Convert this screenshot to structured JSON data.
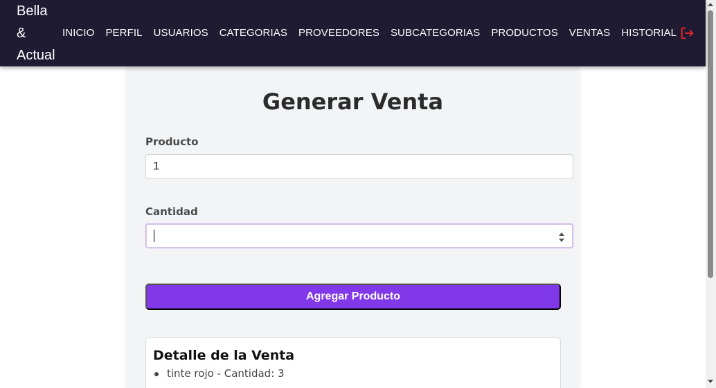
{
  "brand": {
    "line1": "Bella",
    "line2": "&",
    "line3": "Actual"
  },
  "nav": {
    "items": [
      "INICIO",
      "PERFIL",
      "USUARIOS",
      "CATEGORIAS",
      "PROVEEDORES",
      "SUBCATEGORIAS",
      "PRODUCTOS",
      "VENTAS",
      "HISTORIAL"
    ],
    "logout_icon": "logout-icon"
  },
  "form": {
    "title": "Generar Venta",
    "producto_label": "Producto",
    "producto_value": "1",
    "cantidad_label": "Cantidad",
    "cantidad_value": "",
    "button_label": "Agregar Producto"
  },
  "detail": {
    "title": "Detalle de la Venta",
    "items": [
      "tinte rojo - Cantidad: 3"
    ]
  },
  "colors": {
    "navbar": "#1e1b32",
    "accent": "#8038e8",
    "logout": "#e02424"
  }
}
